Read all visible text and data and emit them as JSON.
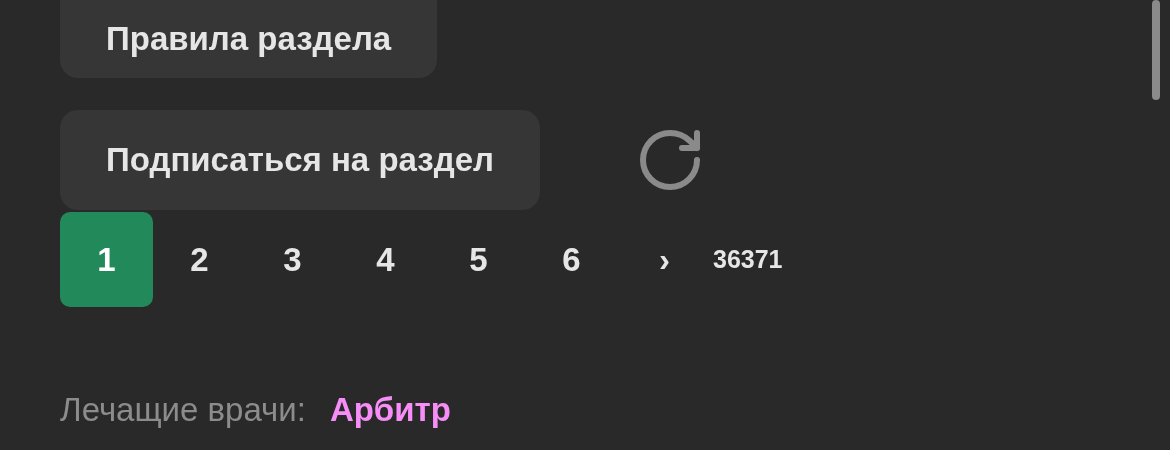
{
  "buttons": [
    "Правила раздела",
    "Подписаться на раздел"
  ],
  "pagination": {
    "pages": [
      {
        "label": "1",
        "selected": true
      },
      {
        "label": "2",
        "selected": false
      },
      {
        "label": "3",
        "selected": false
      },
      {
        "label": "4",
        "selected": false
      },
      {
        "label": "5",
        "selected": false
      },
      {
        "label": "6",
        "selected": false
      }
    ],
    "next": "›",
    "last": "36371"
  },
  "moderators": {
    "label": "Лечащие врачи:",
    "name": "Арбитр"
  }
}
